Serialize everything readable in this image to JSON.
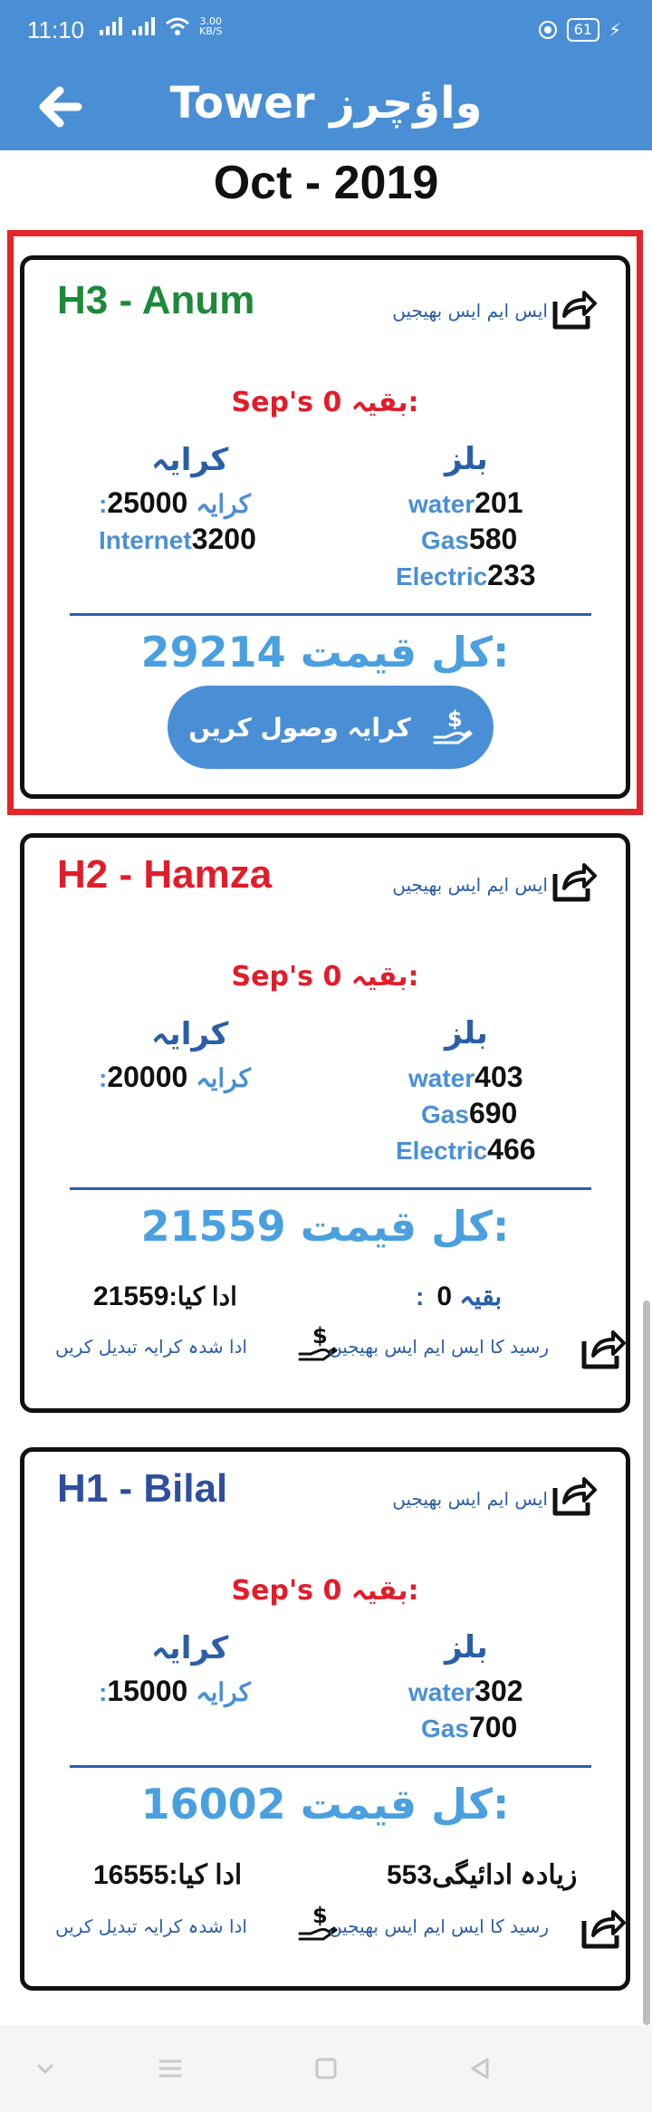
{
  "status_bar": {
    "time": "11:10",
    "speed": "3.00",
    "speed_unit": "KB/S",
    "battery": "61"
  },
  "app_bar": {
    "title": "Tower واؤچرز",
    "back_icon": "back-arrow-icon"
  },
  "month_title": "Oct - 2019",
  "labels": {
    "sms_send": "ایس ایم ایس بھیجیں",
    "remaining": "بقیہ:",
    "rent_header": "کرایہ",
    "bills_header": "بلز",
    "rent_label": ":کرایہ",
    "internet": "Internet",
    "water": "water",
    "gas": "Gas",
    "electric": "Electric",
    "total": "کل قیمت:",
    "collect_rent": "کرایہ وصول کریں",
    "paid": "ادا کیا:",
    "remaining_after": ":بقیہ",
    "overpaid": "زیادہ ادائیگی",
    "receipt_sms": "رسید کا ایس ایم ایس بھیجیں",
    "change_paid_rent": "ادا شدہ کرایہ تبدیل کریں"
  },
  "cards": [
    {
      "name": "H3 - Anum",
      "name_color": "#1d8a3a",
      "prev_month": "Sep's 0",
      "rent": "25000",
      "internet": "3200",
      "water": "201",
      "gas": "580",
      "electric": "233",
      "total": "29214"
    },
    {
      "name": "H2 - Hamza",
      "name_color": "#e21d2a",
      "prev_month": "Sep's 0",
      "rent": "20000",
      "water": "403",
      "gas": "690",
      "electric": "466",
      "total": "21559",
      "paid": "21559",
      "remaining": "0"
    },
    {
      "name": "H1 - Bilal",
      "name_color": "#2f4f9e",
      "prev_month": "Sep's 0",
      "rent": "15000",
      "water": "302",
      "gas": "700",
      "total": "16002",
      "paid": "16555",
      "overpaid": "553"
    }
  ],
  "colors": {
    "primary": "#4a8fd6",
    "selected_border": "#e4262b",
    "total_text": "#4aa0df",
    "remaining_text": "#e21d2a"
  }
}
